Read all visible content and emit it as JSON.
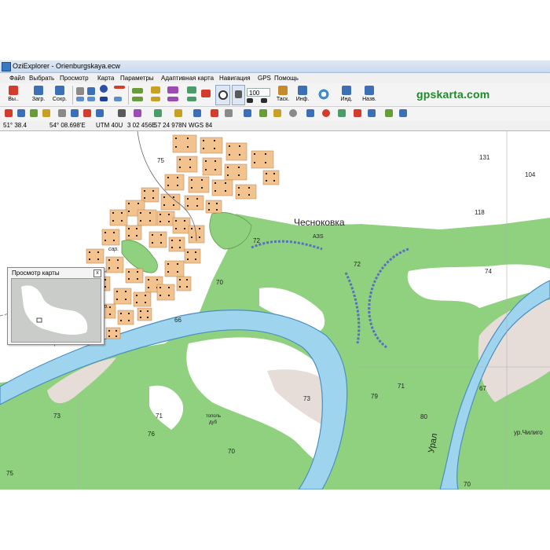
{
  "window": {
    "title": "OziExplorer - Orienburgskaya.ecw"
  },
  "menu": [
    "Файл",
    "Выбрать",
    "Просмотр",
    "Карта",
    "Параметры",
    "Адаптивная карта",
    "Навигация",
    "GPS",
    "Помощь"
  ],
  "toolbar": {
    "buttons": [
      {
        "label": "Вы..",
        "icon": "exit-icon",
        "color": "#d33b2c"
      },
      {
        "label": "Загр.",
        "icon": "load-icon",
        "color": "#3d6fb6"
      },
      {
        "label": "Сохр.",
        "icon": "save-icon",
        "color": "#3d6fb6"
      },
      {
        "label": "Таск.",
        "icon": "drag-hand-icon",
        "color": "#c58a2a"
      },
      {
        "label": "Инф.",
        "icon": "info-icon",
        "color": "#3d6fb6"
      },
      {
        "label": "Инд.",
        "icon": "indicator-icon",
        "color": "#3d6fb6"
      },
      {
        "label": "Назв.",
        "icon": "names-icon",
        "color": "#3d6fb6"
      }
    ],
    "zoom_value": "100",
    "brand": "gpskarta.com"
  },
  "status": {
    "coord1": "51° 38.4",
    "coord2": "54° 08.698'E",
    "utm": "UTM 40U",
    "easting": "3 02 456E",
    "northing": "57 24 978N",
    "datum": "WGS 84"
  },
  "overview": {
    "title": "Просмотр карты",
    "close": "x"
  },
  "map": {
    "labels": {
      "village": "Чесноковка",
      "azs": "АЗS",
      "ural": "Урал",
      "chiligo": "ур.Чилиго",
      "sar": "сар.",
      "topol": "тополь",
      "dub": "дуб"
    },
    "elevations": [
      "131",
      "104",
      "118",
      "72",
      "72",
      "70",
      "74",
      "73",
      "71",
      "71",
      "70",
      "73",
      "75",
      "76",
      "79",
      "80",
      "66",
      "67",
      "75",
      "70"
    ],
    "colors": {
      "green": "#8fd17f",
      "river": "#9fd4ee",
      "riverEdge": "#4a8fc0",
      "house": "#f2c28f",
      "white": "#ffffff"
    }
  }
}
